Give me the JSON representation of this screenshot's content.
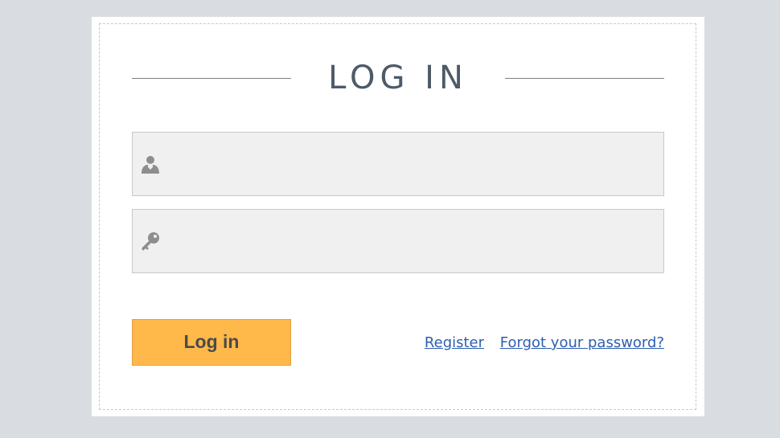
{
  "login": {
    "title": "LOG IN",
    "username_field": {
      "value": "",
      "placeholder": "",
      "icon": "user-icon"
    },
    "password_field": {
      "value": "",
      "placeholder": "",
      "icon": "key-icon"
    },
    "submit_label": "Log in",
    "register_label": "Register",
    "forgot_label": "Forgot your password?"
  },
  "colors": {
    "background": "#d9dde1",
    "card": "#ffffff",
    "button": "#ffb84a",
    "link": "#2f5fb0",
    "title": "#4e5a67"
  }
}
